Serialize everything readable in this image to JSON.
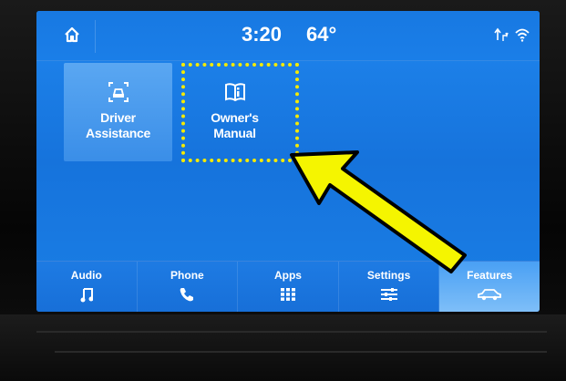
{
  "status": {
    "time": "3:20",
    "temperature": "64°"
  },
  "icons": {
    "home": "home-icon",
    "gps": "gps-signal-icon",
    "wifi": "wifi-icon"
  },
  "tiles": [
    {
      "label_line1": "Driver",
      "label_line2": "Assistance",
      "icon": "driver-assist-icon"
    },
    {
      "label_line1": "Owner's",
      "label_line2": "Manual",
      "icon": "book-icon"
    }
  ],
  "nav": [
    {
      "label": "Audio",
      "icon": "music-note-icon"
    },
    {
      "label": "Phone",
      "icon": "phone-icon"
    },
    {
      "label": "Apps",
      "icon": "apps-grid-icon"
    },
    {
      "label": "Settings",
      "icon": "sliders-icon"
    },
    {
      "label": "Features",
      "icon": "car-icon",
      "active": true
    }
  ],
  "annotation": {
    "highlight_color": "#f5ea00",
    "arrow_color": "#f5f500"
  },
  "colors": {
    "screen_blue": "#1a7ee8",
    "active_tab": "#7fbff8"
  }
}
